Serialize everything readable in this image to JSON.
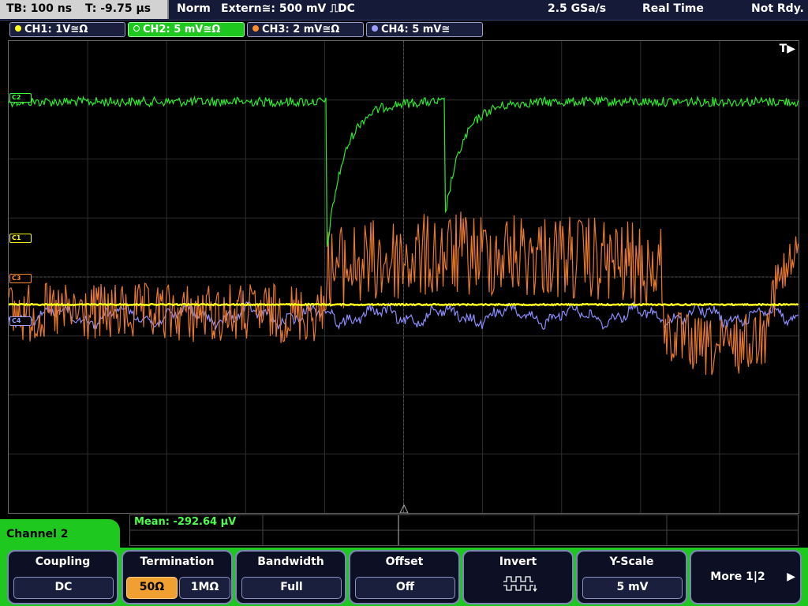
{
  "status": {
    "timebase": "TB: 100 ns",
    "trigger_time": "T: -9.75 µs",
    "mode": "Norm",
    "trigger": "Extern≅: 500 mV ⎍DC",
    "sample_rate": "2.5 GSa/s",
    "acq_mode": "Real Time",
    "ready": "Not Rdy."
  },
  "channels": [
    {
      "label": "CH1: 1V≅Ω",
      "color": "#ffff1e"
    },
    {
      "label": "CH2: 5 mV≅Ω",
      "color": "#3cff3c"
    },
    {
      "label": "CH3: 2 mV≅Ω",
      "color": "#ff8c28"
    },
    {
      "label": "CH4: 5 mV≅",
      "color": "#9a9cff"
    }
  ],
  "markers": {
    "c1": "C1",
    "c2": "C2",
    "c3": "C3",
    "c4": "C4"
  },
  "trigger_marker": "T▶",
  "measurement": "Mean: -292.64 µV",
  "panel_title": "Channel 2",
  "softkeys": {
    "coupling": {
      "label": "Coupling",
      "value": "DC"
    },
    "termination": {
      "label": "Termination",
      "opt1": "50Ω",
      "opt2": "1MΩ"
    },
    "bandwidth": {
      "label": "Bandwidth",
      "value": "Full"
    },
    "offset": {
      "label": "Offset",
      "value": "Off"
    },
    "invert": {
      "label": "Invert"
    },
    "yscale": {
      "label": "Y-Scale",
      "value": "5 mV"
    },
    "more": {
      "label": "More 1|2"
    }
  }
}
